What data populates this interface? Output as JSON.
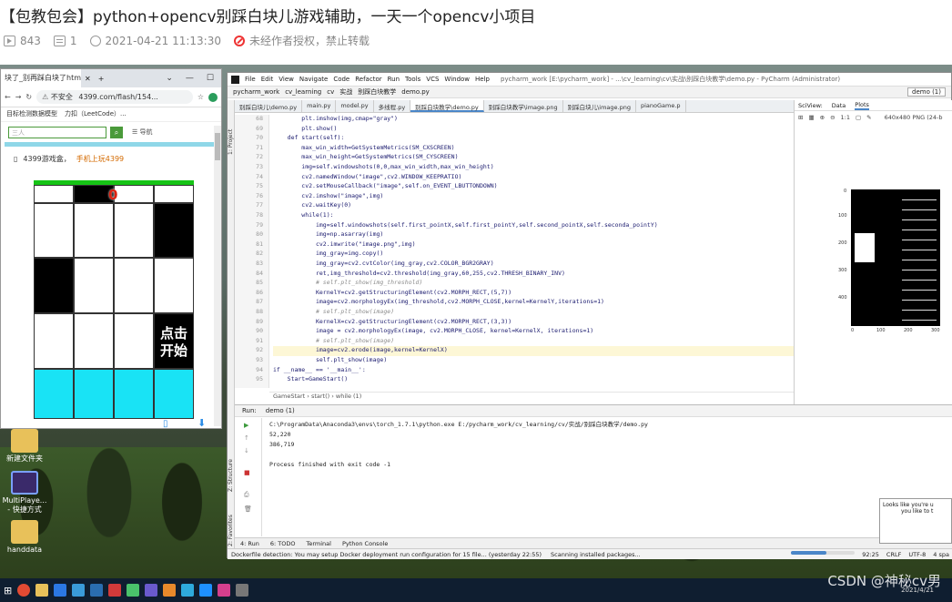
{
  "article": {
    "title": "【包教包会】python+opencv别踩白块儿游戏辅助，一天一个opencv小项目",
    "views": "843",
    "comments": "1",
    "date": "2021-04-21 11:13:30",
    "notice": "未经作者授权，禁止转载"
  },
  "browser": {
    "tab": "块了_别再踩白块了htm",
    "url": "4399.com/flash/154...",
    "insecure": "不安全",
    "bookmarks": [
      "目标检测数据模型",
      "力扣（LeetCode）..."
    ],
    "search_placeholder": "三人",
    "nav_label": "导航",
    "game_head": "4399游戏盒，",
    "game_head_link": "手机上玩4399",
    "start_label": "点击开始",
    "score": "0"
  },
  "desktop": {
    "icons": [
      "新建文件夹",
      "MultiPlaye... - 快捷方式",
      "handdata"
    ]
  },
  "pycharm": {
    "menus": [
      "File",
      "Edit",
      "View",
      "Navigate",
      "Code",
      "Refactor",
      "Run",
      "Tools",
      "VCS",
      "Window",
      "Help"
    ],
    "window_title": "pycharm_work [E:\\pycharm_work] - ...\\cv_learning\\cv\\实战\\别踩白块教学\\demo.py - PyCharm (Administrator)",
    "breadcrumb": [
      "pycharm_work",
      "cv_learning",
      "cv",
      "实战",
      "别踩白块教学",
      "demo.py"
    ],
    "run_config": "demo (1)",
    "tabs": [
      "别踩白块儿\\demo.py",
      "main.py",
      "model.py",
      "多线程.py",
      "别踩白块教学\\demo.py",
      "别踩白块教学\\image.png",
      "别踩白块儿\\image.png",
      "pianoGame.p"
    ],
    "line_numbers": [
      "68",
      "69",
      "70",
      "71",
      "72",
      "73",
      "74",
      "75",
      "76",
      "77",
      "78",
      "79",
      "80",
      "81",
      "82",
      "83",
      "84",
      "85",
      "86",
      "87",
      "88",
      "89",
      "90",
      "91",
      "92",
      "93",
      "94",
      "95"
    ],
    "code": [
      "        plt.imshow(img,cmap=\"gray\")",
      "        plt.show()",
      "    def start(self):",
      "        max_win_width=GetSystemMetrics(SM_CXSCREEN)",
      "        max_win_height=GetSystemMetrics(SM_CYSCREEN)",
      "        img=self.windowshots(0,0,max_win_width,max_win_height)",
      "        cv2.namedWindow(\"image\",cv2.WINDOW_KEEPRATIO)",
      "        cv2.setMouseCallback(\"image\",self.on_EVENT_LBUTTONDOWN)",
      "        cv2.imshow(\"image\",img)",
      "        cv2.waitKey(0)",
      "        while(1):",
      "            img=self.windowshots(self.first_pointX,self.first_pointY,self.second_pointX,self.seconda_pointY)",
      "            img=np.asarray(img)",
      "            cv2.imwrite(\"image.png\",img)",
      "            img_gray=img.copy()",
      "            img_gray=cv2.cvtColor(img_gray,cv2.COLOR_BGR2GRAY)",
      "            ret,img_threshold=cv2.threshold(img_gray,60,255,cv2.THRESH_BINARY_INV)",
      "            # self.plt_show(img_threshold)",
      "            KernelY=cv2.getStructuringElement(cv2.MORPH_RECT,(5,7))",
      "            image=cv2.morphologyEx(img_threshold,cv2.MORPH_CLOSE,kernel=KernelY,iterations=1)",
      "            # self.plt_show(image)",
      "            KernelX=cv2.getStructuringElement(cv2.MORPH_RECT,(3,3))",
      "            image = cv2.morphologyEx(image, cv2.MORPH_CLOSE, kernel=KernelX, iterations=1)",
      "            # self.plt_show(image)",
      "            image=cv2.erode(image,kernel=KernelX)",
      "            self.plt_show(image)",
      "if __name__ == '__main__':",
      "    Start=GameStart()"
    ],
    "code_crumb": "GameStart  ›  start()  ›  while (1)",
    "run": {
      "label": "Run:",
      "tab": "demo (1)",
      "output": [
        "C:\\ProgramData\\Anaconda3\\envs\\torch_1.7.1\\python.exe E:/pycharm_work/cv_learning/cv/实战/别踩白块教学/demo.py",
        "52,220",
        "386,719",
        "",
        "Process finished with exit code -1"
      ]
    },
    "bottom_tabs": [
      "4: Run",
      "6: TODO",
      "Terminal",
      "Python Console"
    ],
    "side_labels": [
      "1: Project",
      "Z: Structure",
      "2: Favorites"
    ],
    "status_left": "Dockerfile detection: You may setup Docker deployment run configuration for 15 file... (yesterday 22:55)",
    "status_mid": "Scanning installed packages...",
    "status_right": [
      "92:25",
      "CRLF",
      "UTF-8",
      "4 spa"
    ],
    "scan_progress": 0.55
  },
  "sciview": {
    "tabs": [
      "SciView:",
      "Data",
      "Plots"
    ],
    "info": "640x480 PNG (24-b",
    "zoom": "1:1",
    "yticks": [
      "0",
      "100",
      "200",
      "300",
      "400"
    ],
    "xticks": [
      "0",
      "100",
      "200",
      "300"
    ]
  },
  "popup": {
    "line1": "Looks like you're u",
    "line2": "you like to t"
  },
  "watermark": "CSDN @神秘cv男",
  "clock": "2021/4/21"
}
